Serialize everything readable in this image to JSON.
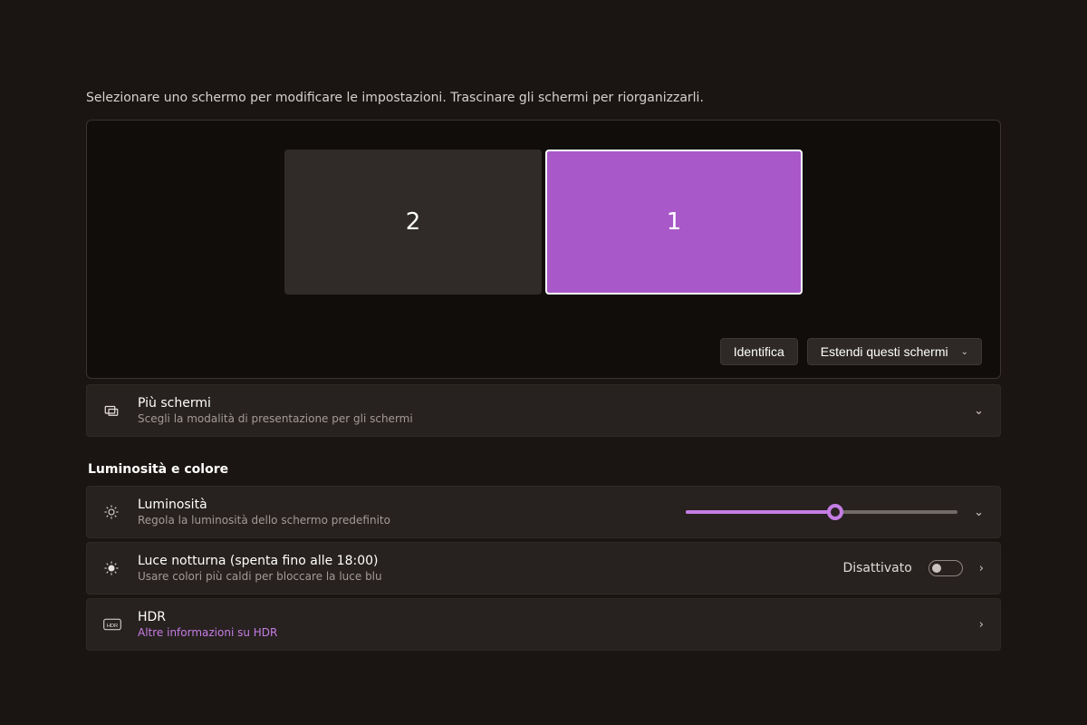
{
  "helper_text": "Selezionare uno schermo per modificare le impostazioni. Trascinare gli schermi per riorganizzarli.",
  "monitors": {
    "secondary_label": "2",
    "primary_label": "1"
  },
  "actions": {
    "identify": "Identifica",
    "extend": "Estendi questi schermi"
  },
  "multi": {
    "title": "Più schermi",
    "subtitle": "Scegli la modalità di presentazione per gli schermi"
  },
  "section_bc": "Luminosità e colore",
  "brightness": {
    "title": "Luminosità",
    "subtitle": "Regola la luminosità dello schermo predefinito",
    "value_percent": 55
  },
  "nightlight": {
    "title": "Luce notturna (spenta fino alle 18:00)",
    "subtitle": "Usare colori più caldi per bloccare la luce blu",
    "state": "Disattivato"
  },
  "hdr": {
    "title": "HDR",
    "subtitle": "Altre informazioni su HDR"
  },
  "colors": {
    "accent": "#a858c8",
    "slider": "#c57de4"
  }
}
